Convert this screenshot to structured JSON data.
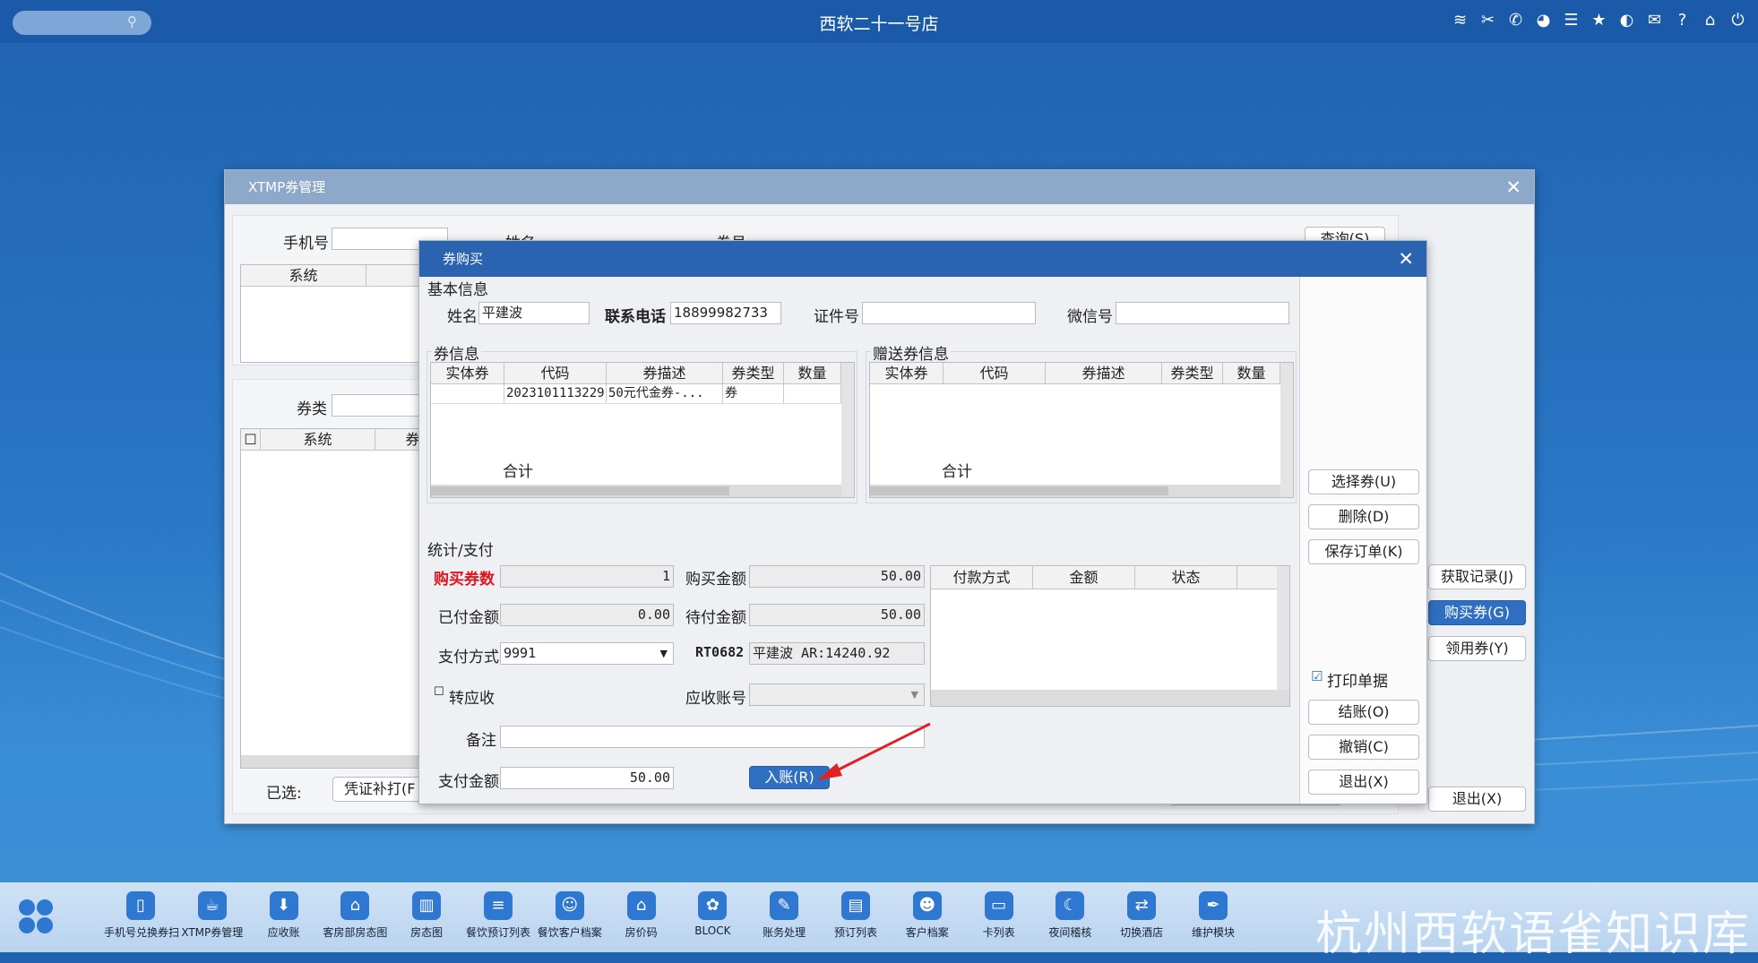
{
  "topbar": {
    "search_placeholder": "",
    "title": "西软二十一号店",
    "icons": [
      "wifi-icon",
      "tools-icon",
      "phone-icon",
      "palette-icon",
      "menu-icon",
      "star-icon",
      "moon-icon",
      "mail-icon",
      "help-icon",
      "home-icon",
      "power-icon"
    ],
    "glyphs": [
      "≋",
      "✂",
      "✆",
      "◕",
      "☰",
      "★",
      "◐",
      "✉",
      "?",
      "⌂",
      "⏻"
    ]
  },
  "outer": {
    "title": "XTMP券管理",
    "phone_label": "手机号",
    "name_label": "姓名",
    "coupon_no_label": "券号",
    "query_button": "查询(S)",
    "grid1_headers": [
      "系统"
    ],
    "coupon_type_label": "券类",
    "grid2_headers": [
      "系统",
      "券代"
    ],
    "selected_label": "已选:",
    "reprint_button": "凭证补打(F",
    "fetch_button": "获取记录(J)",
    "buy_button": "购买券(G)",
    "claim_button": "领用券(Y)",
    "exit_button": "退出(X)"
  },
  "dialog": {
    "title": "券购买",
    "basic_title": "基本信息",
    "name_label": "姓名",
    "name_value": "平建波",
    "contact_label": "联系电话",
    "contact_value": "18899982733",
    "id_label": "证件号",
    "id_value": "",
    "wechat_label": "微信号",
    "wechat_value": "",
    "coupon_info_title": "券信息",
    "coupon_headers": [
      "实体券",
      "代码",
      "券描述",
      "券类型",
      "数量"
    ],
    "coupon_rows": [
      {
        "physical": "",
        "code": "2023101113229",
        "desc": "50元代金券-...",
        "type": "券",
        "qty": ""
      }
    ],
    "coupon_total": "合计",
    "gift_title": "赠送券信息",
    "gift_headers": [
      "实体券",
      "代码",
      "券描述",
      "券类型",
      "数量"
    ],
    "gift_total": "合计",
    "stats_title": "统计/支付",
    "buy_count_label": "购买券数",
    "buy_count": "1",
    "buy_amount_label": "购买金额",
    "buy_amount": "50.00",
    "paid_label": "已付金额",
    "paid": "0.00",
    "due_label": "待付金额",
    "due": "50.00",
    "pay_method_label": "支付方式",
    "pay_method": "9991",
    "account_code": "RT0682",
    "account_name": "平建波",
    "account_ar": "AR:14240.92",
    "to_receivable_label": "转应收",
    "receivable_acct_label": "应收账号",
    "receivable_acct": "",
    "remark_label": "备注",
    "remark": "",
    "pay_amount_label": "支付金额",
    "pay_amount": "50.00",
    "post_button": "入账(R)",
    "pay_headers": [
      "付款方式",
      "金额",
      "状态"
    ],
    "select_coupon_button": "选择券(U)",
    "delete_button": "删除(D)",
    "save_order_button": "保存订单(K)",
    "print_receipt_label": "打印单据",
    "checkout_button": "结账(O)",
    "cancel_button": "撤销(C)",
    "exit_button": "退出(X)",
    "accent": "#2f6fc1",
    "required_color": "#e0141e"
  },
  "taskbar": {
    "items": [
      {
        "label": "手机号兑换券扫",
        "icon": "▯"
      },
      {
        "label": "XTMP券管理",
        "icon": "☕"
      },
      {
        "label": "应收账",
        "icon": "⬇"
      },
      {
        "label": "客房部房态图",
        "icon": "⌂"
      },
      {
        "label": "房态图",
        "icon": "▥"
      },
      {
        "label": "餐饮预订列表",
        "icon": "≡"
      },
      {
        "label": "餐饮客户档案",
        "icon": "☺"
      },
      {
        "label": "房价码",
        "icon": "⌂"
      },
      {
        "label": "BLOCK",
        "icon": "✿"
      },
      {
        "label": "账务处理",
        "icon": "✎"
      },
      {
        "label": "预订列表",
        "icon": "▤"
      },
      {
        "label": "客户档案",
        "icon": "☻"
      },
      {
        "label": "卡列表",
        "icon": "▭"
      },
      {
        "label": "夜间稽核",
        "icon": "☾"
      },
      {
        "label": "切换酒店",
        "icon": "⇄"
      },
      {
        "label": "维护模块",
        "icon": "✒"
      }
    ],
    "watermark": "杭州西软语雀知识库"
  }
}
